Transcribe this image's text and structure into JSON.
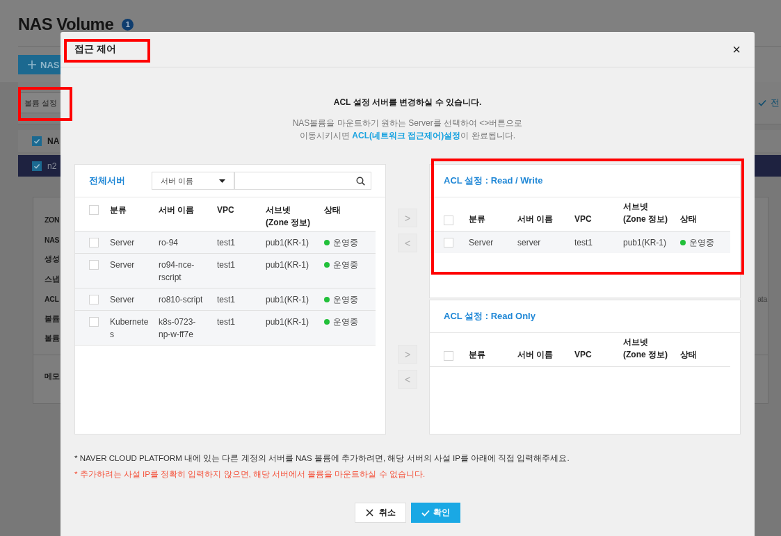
{
  "page": {
    "title": "NAS Volume",
    "badge": "1",
    "create_button": "NAS",
    "settings_button": "볼륨 설정",
    "toolbar_right": "전",
    "table_header": {
      "label": "NA",
      "checked": true
    },
    "row": {
      "label": "n2",
      "checked": true,
      "selected": true
    },
    "details": [
      {
        "label": "ZON"
      },
      {
        "label": "NAS"
      },
      {
        "label": "생성"
      },
      {
        "label": "스냅"
      },
      {
        "label": "ACL",
        "value": "ata"
      },
      {
        "label": "볼륨"
      },
      {
        "label": "볼륨"
      }
    ],
    "memo_label": "메모"
  },
  "dialog": {
    "title": "접근 제어",
    "close": "×",
    "heading": "ACL 설정 서버를 변경하실 수 있습니다.",
    "description": [
      "NAS볼륨을 마운트하기 원하는 Server를 선택하여 <>버튼으로",
      "이동시키시면 **ACL(네트워크 접근제어)설정**이 완료됩니다."
    ],
    "all_servers": {
      "title": "전체서버",
      "filter": "서버 이름",
      "columns": [
        "분류",
        "서버 이름",
        "VPC",
        "서브넷\n(Zone 정보)",
        "상태"
      ],
      "all_checked": false,
      "rows": [
        {
          "type": "Server",
          "name": "ro-94",
          "vpc": "test1",
          "subnet": "pub1(KR-1)",
          "status": "운영중",
          "color": "#22c03a",
          "checked": false
        },
        {
          "type": "Server",
          "name": "ro94-nce-rscript",
          "vpc": "test1",
          "subnet": "pub1(KR-1)",
          "status": "운영중",
          "color": "#22c03a",
          "checked": false
        },
        {
          "type": "Server",
          "name": "ro810-script",
          "vpc": "test1",
          "subnet": "pub1(KR-1)",
          "status": "운영중",
          "color": "#22c03a",
          "checked": false
        },
        {
          "type": "Kubernetes",
          "name": "k8s-0723-np-w-ff7e",
          "vpc": "test1",
          "subnet": "pub1(KR-1)",
          "status": "운영중",
          "color": "#22c03a",
          "checked": false
        }
      ]
    },
    "acl_groups": [
      {
        "title": "ACL 설정 : Read / Write",
        "columns": [
          "분류",
          "서버 이름",
          "VPC",
          "서브넷\n(Zone 정보)",
          "상태"
        ],
        "all_checked": false,
        "rows": [
          {
            "type": "Server",
            "name": "server",
            "vpc": "test1",
            "subnet": "pub1(KR-1)",
            "status": "운영중",
            "color": "#22c03a",
            "checked": false
          }
        ]
      },
      {
        "title": "ACL 설정 : Read Only",
        "columns": [
          "분류",
          "서버 이름",
          "VPC",
          "서브넷\n(Zone 정보)",
          "상태"
        ],
        "all_checked": false
      }
    ],
    "move_buttons": [
      [
        ">",
        "<"
      ],
      [
        ">",
        "<"
      ]
    ],
    "notes": [
      {
        "text": "* NAVER CLOUD PLATFORM 내에 있는 다른 계정의 서버를 NAS 볼륨에 추가하려면, 해당 서버의 사설 IP를 아래에 직접 입력해주세요.",
        "kind": "info"
      },
      {
        "text": "* 추가하려는 사설 IP를 정확히 입력하지 않으면, 해당 서버에서 볼륨을 마운트하실 수 없습니다.",
        "kind": "warning"
      }
    ],
    "cancel_button": "취소",
    "confirm_button": "확인"
  }
}
